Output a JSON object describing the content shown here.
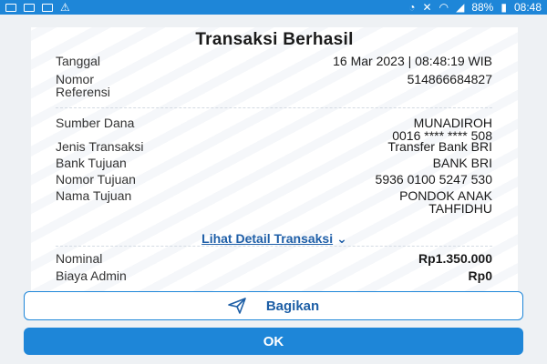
{
  "status_bar": {
    "battery": "88%",
    "time": "08:48"
  },
  "receipt": {
    "title": "Transaksi Berhasil",
    "date_label": "Tanggal",
    "date_value": "16 Mar 2023 | 08:48:19 WIB",
    "ref_label_line1": "Nomor",
    "ref_label_line2": "Referensi",
    "ref_value": "514866684827",
    "source_label": "Sumber Dana",
    "source_value_line1": "MUNADIROH",
    "source_value_line2": "0016 **** **** 508",
    "type_label": "Jenis Transaksi",
    "type_value": "Transfer Bank BRI",
    "bank_label": "Bank Tujuan",
    "bank_value": "BANK BRI",
    "dest_number_label": "Nomor Tujuan",
    "dest_number_value": "5936 0100 5247 530",
    "dest_name_label": "Nama Tujuan",
    "dest_name_value_line1": "PONDOK ANAK",
    "dest_name_value_line2": "TAHFIDHU",
    "detail_link": "Lihat Detail Transaksi",
    "nominal_label": "Nominal",
    "nominal_value": "Rp1.350.000",
    "fee_label": "Biaya Admin",
    "fee_value": "Rp0"
  },
  "actions": {
    "share_label": "Bagikan",
    "ok_label": "OK"
  },
  "colors": {
    "primary": "#1e86d8",
    "link": "#1f5fa8"
  }
}
